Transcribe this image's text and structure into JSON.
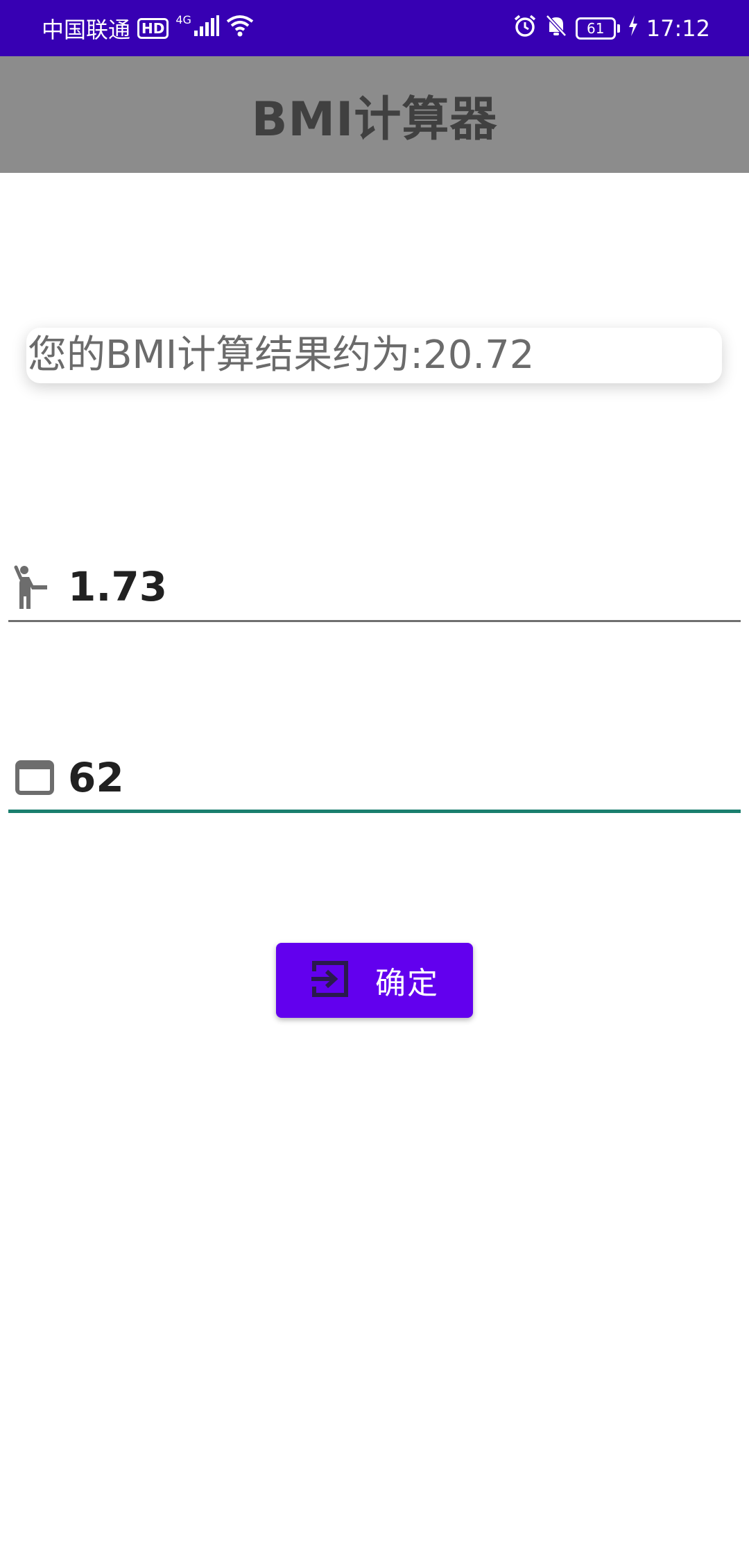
{
  "status_bar": {
    "carrier": "中国联通",
    "hd_badge": "HD",
    "network_type": "4G",
    "battery_level": "61",
    "time": "17:12",
    "icons": [
      "signal-icon",
      "wifi-icon",
      "alarm-icon",
      "bell-off-icon",
      "battery-icon",
      "charging-icon"
    ]
  },
  "app_bar": {
    "title": "BMI计算器"
  },
  "result": {
    "text": "您的BMI计算结果约为:20.72"
  },
  "height_field": {
    "icon": "person-icon",
    "value": "1.73"
  },
  "weight_field": {
    "icon": "window-icon",
    "value": "62"
  },
  "confirm_button": {
    "icon": "login-icon",
    "label": "确定"
  },
  "colors": {
    "status_bar": "#3700b3",
    "app_bar": "#8c8c8c",
    "button": "#6200ee",
    "active_underline": "#1a7f6e"
  }
}
